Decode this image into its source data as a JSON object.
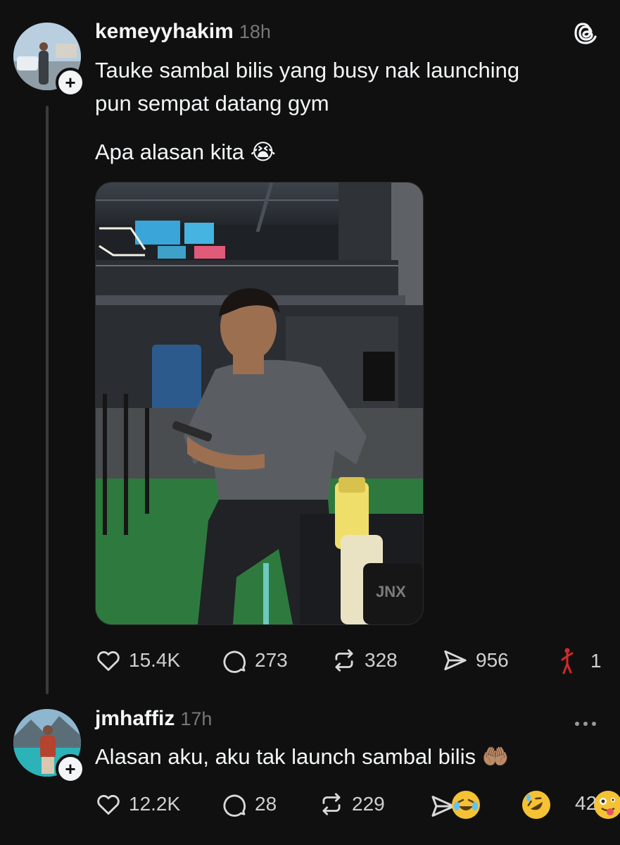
{
  "post": {
    "username": "kemeyyhakim",
    "time": "18h",
    "text_line1": "Tauke sambal bilis yang busy nak launching",
    "text_line2": "pun sempat datang gym",
    "text_line3": "Apa alasan kita",
    "emoji_1": "😭",
    "likes": "15.4K",
    "replies": "273",
    "reposts": "328",
    "shares": "956",
    "extra_count": "1"
  },
  "reply": {
    "username": "jmhaffiz",
    "time": "17h",
    "text": "Alasan aku, aku tak launch sambal bilis",
    "emoji": "🤲🏽",
    "likes": "12.2K",
    "replies": "28",
    "reposts": "229",
    "reaction_count": "42"
  },
  "icons": {
    "app_logo": "threads-logo-icon",
    "like": "heart-icon",
    "reply": "comment-bubble-icon",
    "repost": "repost-icon",
    "share": "send-icon",
    "more": "more-dots-icon",
    "follow": "plus-icon"
  },
  "colors": {
    "background": "#101010",
    "text": "#f3f5f7",
    "muted": "#777777",
    "thread_line": "#3b3b3b"
  }
}
